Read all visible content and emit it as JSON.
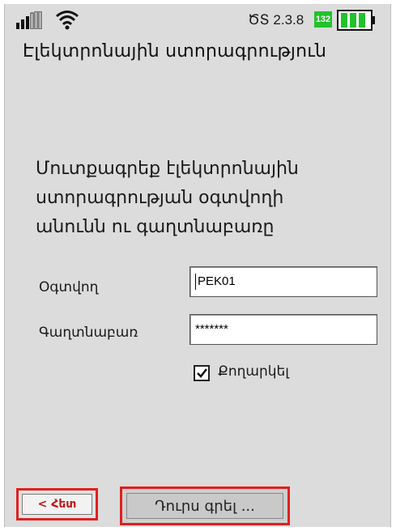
{
  "status_bar": {
    "version": "ԾՏ 2.3.8",
    "battery_badge": "132",
    "battery_color": "#22c22c",
    "icons": [
      "signal-icon",
      "wifi-icon",
      "battery-icon"
    ]
  },
  "app_title": "Էլեկտրոնային ստորագրություն",
  "instructions": "Մուտքագրեք էլեկտրոնային\nստորագրության օգտվողի\nանունն ու գաղտնաբառը",
  "form": {
    "username_label": "Օգտվող",
    "username_value": "PEK01",
    "password_label": "Գաղտնաբառ",
    "password_value": "*******",
    "remember_label": "Քողարկել",
    "remember_checked": true
  },
  "buttons": {
    "back": "< Հետ",
    "logout": "Դուրս գրել ..."
  },
  "colors": {
    "highlight_border": "#e02020",
    "screen_background": "#dcdcdc"
  }
}
